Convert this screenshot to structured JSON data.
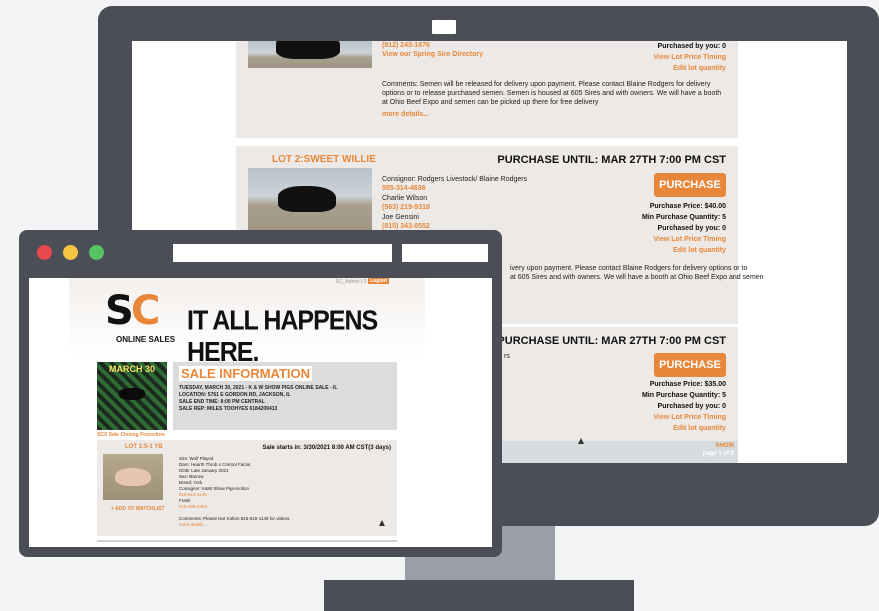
{
  "monitor": {
    "card1": {
      "phone": "(812) 243-1676",
      "directory_link": "View our Spring Sire Directory",
      "purchased_by_you": "Purchased by you: 0",
      "view_timing": "View Lot Price Timing",
      "edit_qty": "Edit lot quantity",
      "comments": "Comments: Semen will be released for delivery upon payment. Please contact Blaine Rodgers for delivery options or to release purchased semen. Semen is housed at 605 Sires and with owners. We will have a booth at Ohio Beef Expo and semen can be picked up there for free delivery",
      "more": "more details..."
    },
    "card2": {
      "lot_title": "LOT 2:SWEET WILLIE",
      "purchase_until": "PURCHASE UNTIL: MAR 27TH 7:00 PM CST",
      "purchase_btn": "PURCHASE",
      "consignor": "Consignor: Rodgers Livestock/ Blaine Rodgers",
      "phone1": "555-314-4636",
      "contact2": "Charlie Wilson",
      "phone2": "(563) 219-9318",
      "contact3": "Joe Gensini",
      "phone3": "(815) 343-0552",
      "price": "Purchase Price: $40.00",
      "min_qty": "Min Purchase Quantity: 5",
      "purchased_by_you": "Purchased by you: 0",
      "view_timing": "View Lot Price Timing",
      "edit_qty": "Edit lot quantity",
      "comment1": "ivery upon payment. Please contact Blaine Rodgers for delivery options or to",
      "comment2": "at 605 Sires and with owners. We will have a booth at Ohio Beef Expo and semen"
    },
    "card3": {
      "purchase_until": "PURCHASE UNTIL: MAR 27TH 7:00 PM CST",
      "purchase_btn": "PURCHASE",
      "fragment": "rs",
      "price": "Purchase Price: $35.00",
      "min_qty": "Min Purchase Quantity: 5",
      "purchased_by_you": "Purchased by you: 0",
      "view_timing": "View Lot Price Timing",
      "edit_qty": "Edit lot quantity"
    },
    "pager": {
      "show": "SHOW",
      "pages": "page 1 of 0"
    }
  },
  "site": {
    "header_user": "SC_Admin | 0 Items",
    "logout": "Logout",
    "logo_s": "S",
    "logo_c": "C",
    "online_sales": "ONLINE SALES",
    "tagline": "IT ALL HAPPENS HERE.",
    "flyer_title": "MARCH 30",
    "sale_info": {
      "title": "SALE INFORMATION",
      "line1": "TUESDAY, MARCH 30, 2021 - K & W SHOW PIGS ONLINE SALE - IL",
      "location": "LOCATION: 5761 E GORDON RD, JACKSON, IL",
      "end_time": "SALE END TIME: 8:00 PM CENTRAL",
      "rep": "SALE REP: MILES TOOHYES 6184209413"
    },
    "closing": "SCX Sale Closing Procedure",
    "lot": {
      "name": "LOT 1:5-1 YB",
      "sale_starts": "Sale starts in: 3/30/2021 8:00 AM CST(3 days)",
      "watchlist": "+ ADD TO WATCHLIST",
      "sire": "Sire: Wolf Played",
      "dam": "Dam: Hearth Throb x Control Factor",
      "dob": "DOB: Late January 2021",
      "sex": "Sex: Barrow",
      "breed": "Breed: York",
      "consignor": "Consignor: K&W Show Pigs-Kolton",
      "phone1": "815-515-1149",
      "contact2": "Frank",
      "phone2": "815-496-2353",
      "comments": "Comments: Please text Kolton 815-515-1149 for videos.",
      "more": "more details..."
    }
  }
}
